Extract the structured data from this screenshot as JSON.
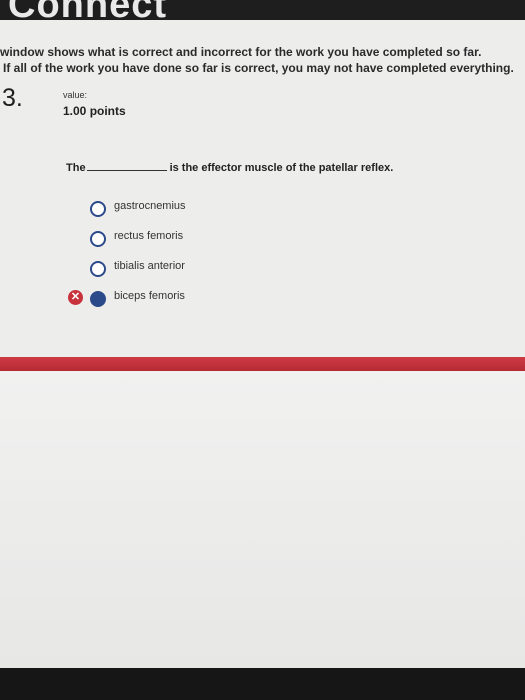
{
  "notice": {
    "line1": "window shows what is correct and incorrect for the work you have completed so far.",
    "line2": "If all of the work you have done so far is correct, you may not have completed everything."
  },
  "question": {
    "number": "3.",
    "value_label": "value:",
    "value": "1.00 points",
    "prefix": "The",
    "suffix": "is the effector muscle of the patellar reflex.",
    "options": [
      {
        "label": "gastrocnemius",
        "selected": false,
        "marked_wrong": false
      },
      {
        "label": "rectus femoris",
        "selected": false,
        "marked_wrong": false
      },
      {
        "label": "tibialis anterior",
        "selected": false,
        "marked_wrong": false
      },
      {
        "label": "biceps femoris",
        "selected": true,
        "marked_wrong": true
      }
    ]
  },
  "wrong_mark_glyph": "✕",
  "colors": {
    "radio": "#2b4a8a",
    "wrong": "#c8323c",
    "divider": "#c8323c"
  }
}
